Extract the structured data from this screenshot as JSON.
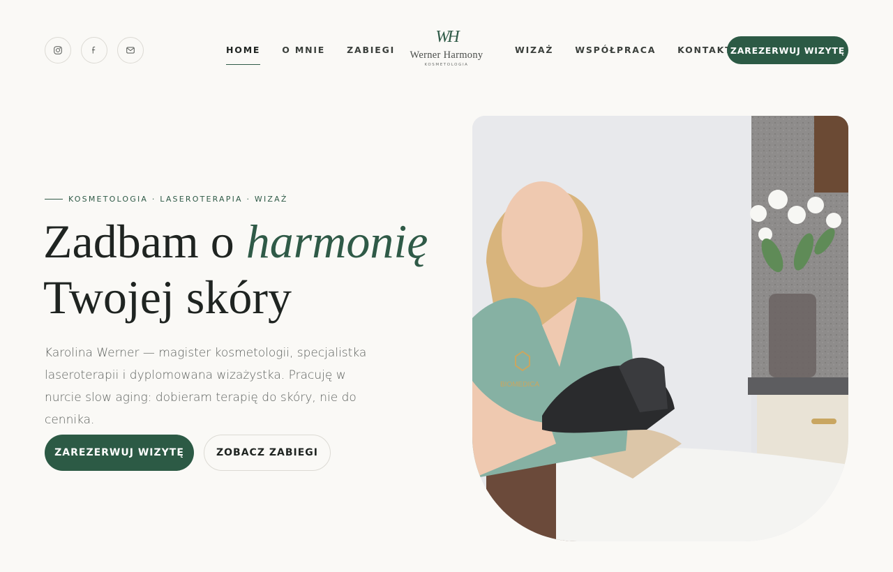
{
  "header": {
    "social": [
      {
        "icon": "instagram-icon"
      },
      {
        "icon": "facebook-icon"
      },
      {
        "icon": "mail-icon"
      }
    ],
    "nav_left": [
      "HOME",
      "O MNIE",
      "ZABIEGI"
    ],
    "nav_right": [
      "WIZAŻ",
      "WSPÓŁPRACA",
      "KONTAKT"
    ],
    "active_nav": "HOME",
    "logo": {
      "mark": "WH",
      "name": "Werner Harmony",
      "sub": "KOSMETOLOGIA"
    },
    "book_button": "ZAREZERWUJ WIZYTĘ"
  },
  "hero": {
    "eyebrow": "KOSMETOLOGIA · LASEROTERAPIA · WIZAŻ",
    "headline_part1": "Zadbam o ",
    "headline_accent": "harmonię",
    "headline_part2": "Twojej skóry",
    "lead": "Karolina Werner — magister kosmetologii, specjalistka laseroterapii i dyplomowana wizażystka. Pracuję w nurcie slow aging: dobieram terapię do skóry, nie do cennika.",
    "cta_primary": "ZAREZERWUJ WIZYTĘ",
    "cta_secondary": "ZOBACZ ZABIEGI",
    "uniform_logo_text": "BIOMEDICA"
  },
  "colors": {
    "brand": "#2c5a45",
    "background": "#faf9f6",
    "text": "#1f2421"
  }
}
